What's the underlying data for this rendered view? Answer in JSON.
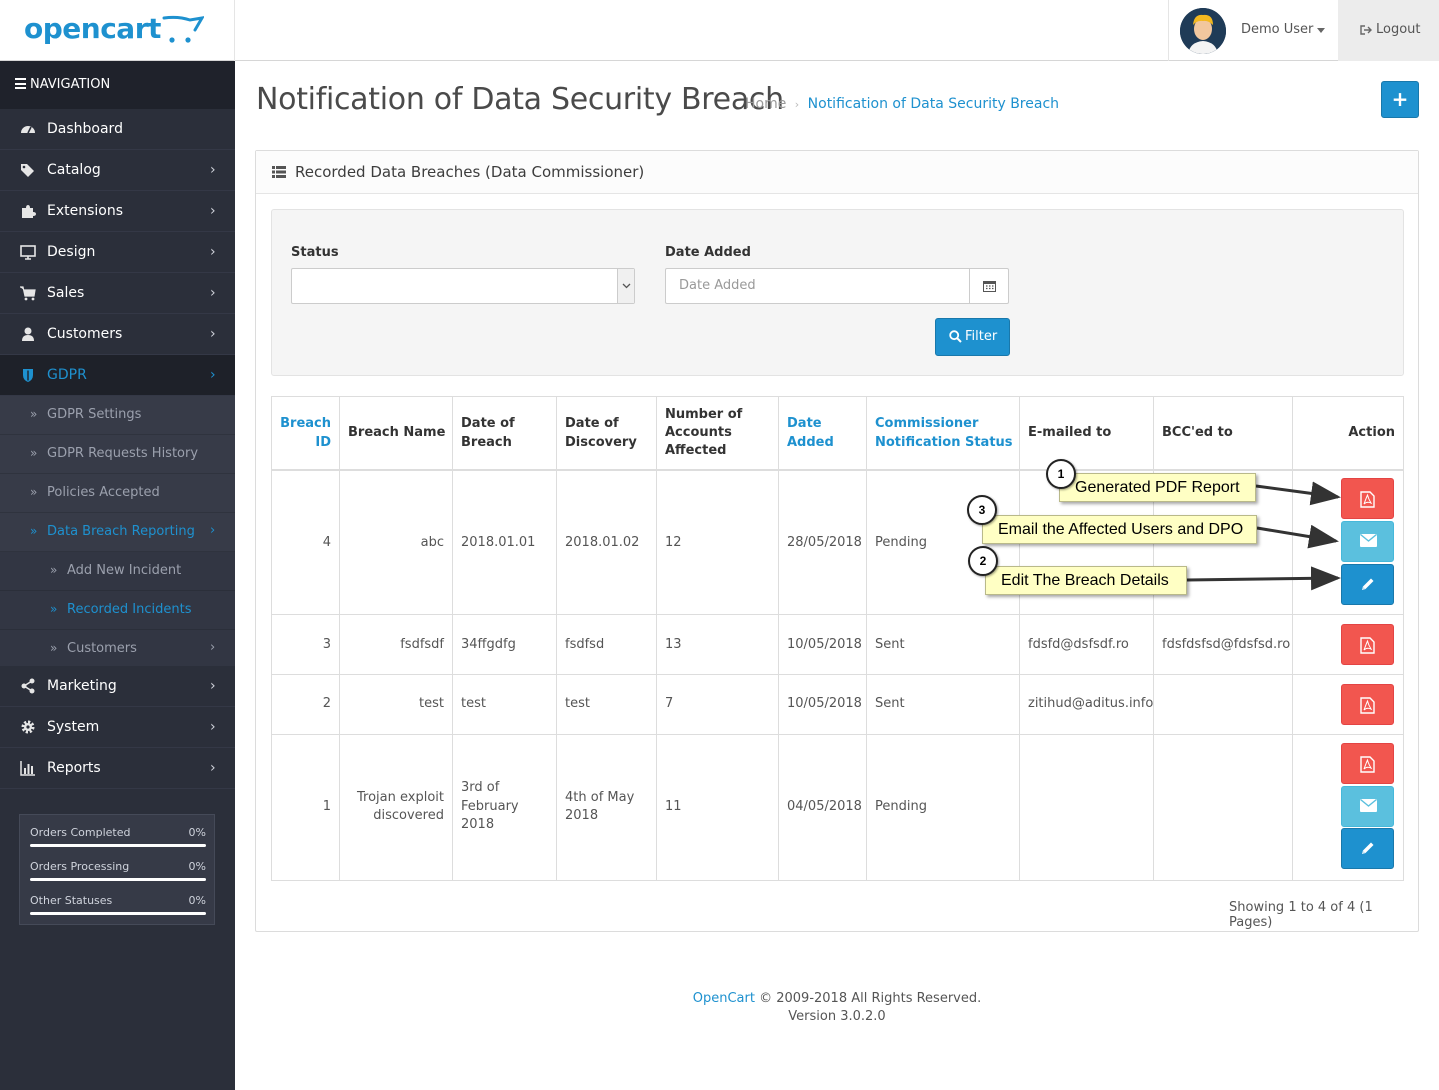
{
  "header": {
    "logo_text": "opencart",
    "user_name": "Demo User",
    "logout_label": "Logout"
  },
  "sidebar": {
    "heading": "NAVIGATION",
    "items": [
      {
        "label": "Dashboard",
        "icon": "dashboard-icon"
      },
      {
        "label": "Catalog",
        "icon": "tags-icon"
      },
      {
        "label": "Extensions",
        "icon": "puzzle-icon"
      },
      {
        "label": "Design",
        "icon": "monitor-icon"
      },
      {
        "label": "Sales",
        "icon": "cart-icon"
      },
      {
        "label": "Customers",
        "icon": "user-icon"
      },
      {
        "label": "GDPR",
        "icon": "shield-icon"
      },
      {
        "label": "Marketing",
        "icon": "share-icon"
      },
      {
        "label": "System",
        "icon": "gear-icon"
      },
      {
        "label": "Reports",
        "icon": "bar-chart-icon"
      }
    ],
    "gdpr_sub": [
      {
        "label": "GDPR Settings"
      },
      {
        "label": "GDPR Requests History"
      },
      {
        "label": "Policies Accepted"
      },
      {
        "label": "Data Breach Reporting"
      }
    ],
    "breach_sub": [
      {
        "label": "Add New Incident"
      },
      {
        "label": "Recorded Incidents"
      },
      {
        "label": "Customers"
      }
    ],
    "stats": [
      {
        "label": "Orders Completed",
        "value": "0%"
      },
      {
        "label": "Orders Processing",
        "value": "0%"
      },
      {
        "label": "Other Statuses",
        "value": "0%"
      }
    ]
  },
  "page": {
    "title": "Notification of Data Security Breach",
    "breadcrumb": {
      "home": "Home",
      "sep": "›",
      "current": "Notification of Data Security Breach"
    },
    "add_button": "+"
  },
  "panel": {
    "title": "Recorded Data Breaches (Data Commissioner)"
  },
  "filter": {
    "status_label": "Status",
    "status_value": "",
    "date_label": "Date Added",
    "date_placeholder": "Date Added",
    "button": "Filter"
  },
  "table": {
    "headers": {
      "id": [
        "Breach",
        "ID"
      ],
      "name": [
        "Breach Name"
      ],
      "date_breach": [
        "Date of",
        "Breach"
      ],
      "date_discovery": [
        "Date of",
        "Discovery"
      ],
      "accounts": [
        "Number of",
        "Accounts",
        "Affected"
      ],
      "date_added": [
        "Date",
        "Added"
      ],
      "status": [
        "Commissioner",
        "Notification Status"
      ],
      "emailed": [
        "E-mailed to"
      ],
      "bcc": [
        "BCC'ed to"
      ],
      "action": [
        "Action"
      ]
    },
    "rows": [
      {
        "id": "4",
        "name": [
          "abc"
        ],
        "date_breach": [
          "2018.01.01"
        ],
        "date_discovery": [
          "2018.01.02"
        ],
        "accounts": "12",
        "date_added": "28/05/2018",
        "status": "Pending",
        "emailed": "",
        "bcc": ""
      },
      {
        "id": "3",
        "name": [
          "fsdfsdf"
        ],
        "date_breach": [
          "34ffgdfg"
        ],
        "date_discovery": [
          "fsdfsd"
        ],
        "accounts": "13",
        "date_added": "10/05/2018",
        "status": "Sent",
        "emailed": "fdsfd@dsfsdf.ro",
        "bcc": "fdsfdsfsd@fdsfsd.ro"
      },
      {
        "id": "2",
        "name": [
          "test"
        ],
        "date_breach": [
          "test"
        ],
        "date_discovery": [
          "test"
        ],
        "accounts": "7",
        "date_added": "10/05/2018",
        "status": "Sent",
        "emailed": "zitihud@aditus.info",
        "bcc": ""
      },
      {
        "id": "1",
        "name": [
          "Trojan exploit",
          "discovered"
        ],
        "date_breach": [
          "3rd of",
          "February",
          "2018"
        ],
        "date_discovery": [
          "4th of May",
          "2018"
        ],
        "accounts": "11",
        "date_added": "04/05/2018",
        "status": "Pending",
        "emailed": "",
        "bcc": ""
      }
    ]
  },
  "pagination": "Showing 1 to 4 of 4 (1 Pages)",
  "callouts": [
    {
      "number": "1",
      "text": "Generated PDF Report"
    },
    {
      "number": "3",
      "text": "Email the Affected Users and DPO"
    },
    {
      "number": "2",
      "text": "Edit The Breach Details"
    }
  ],
  "footer": {
    "brand": "OpenCart",
    "copyright": " © 2009-2018 All Rights Reserved.",
    "version": "Version 3.0.2.0"
  },
  "colors": {
    "primary": "#1e91cf",
    "danger": "#f2564f",
    "info": "#5bc0de",
    "sidebar": "#2b2f3a",
    "callout": "#ffffc4"
  }
}
